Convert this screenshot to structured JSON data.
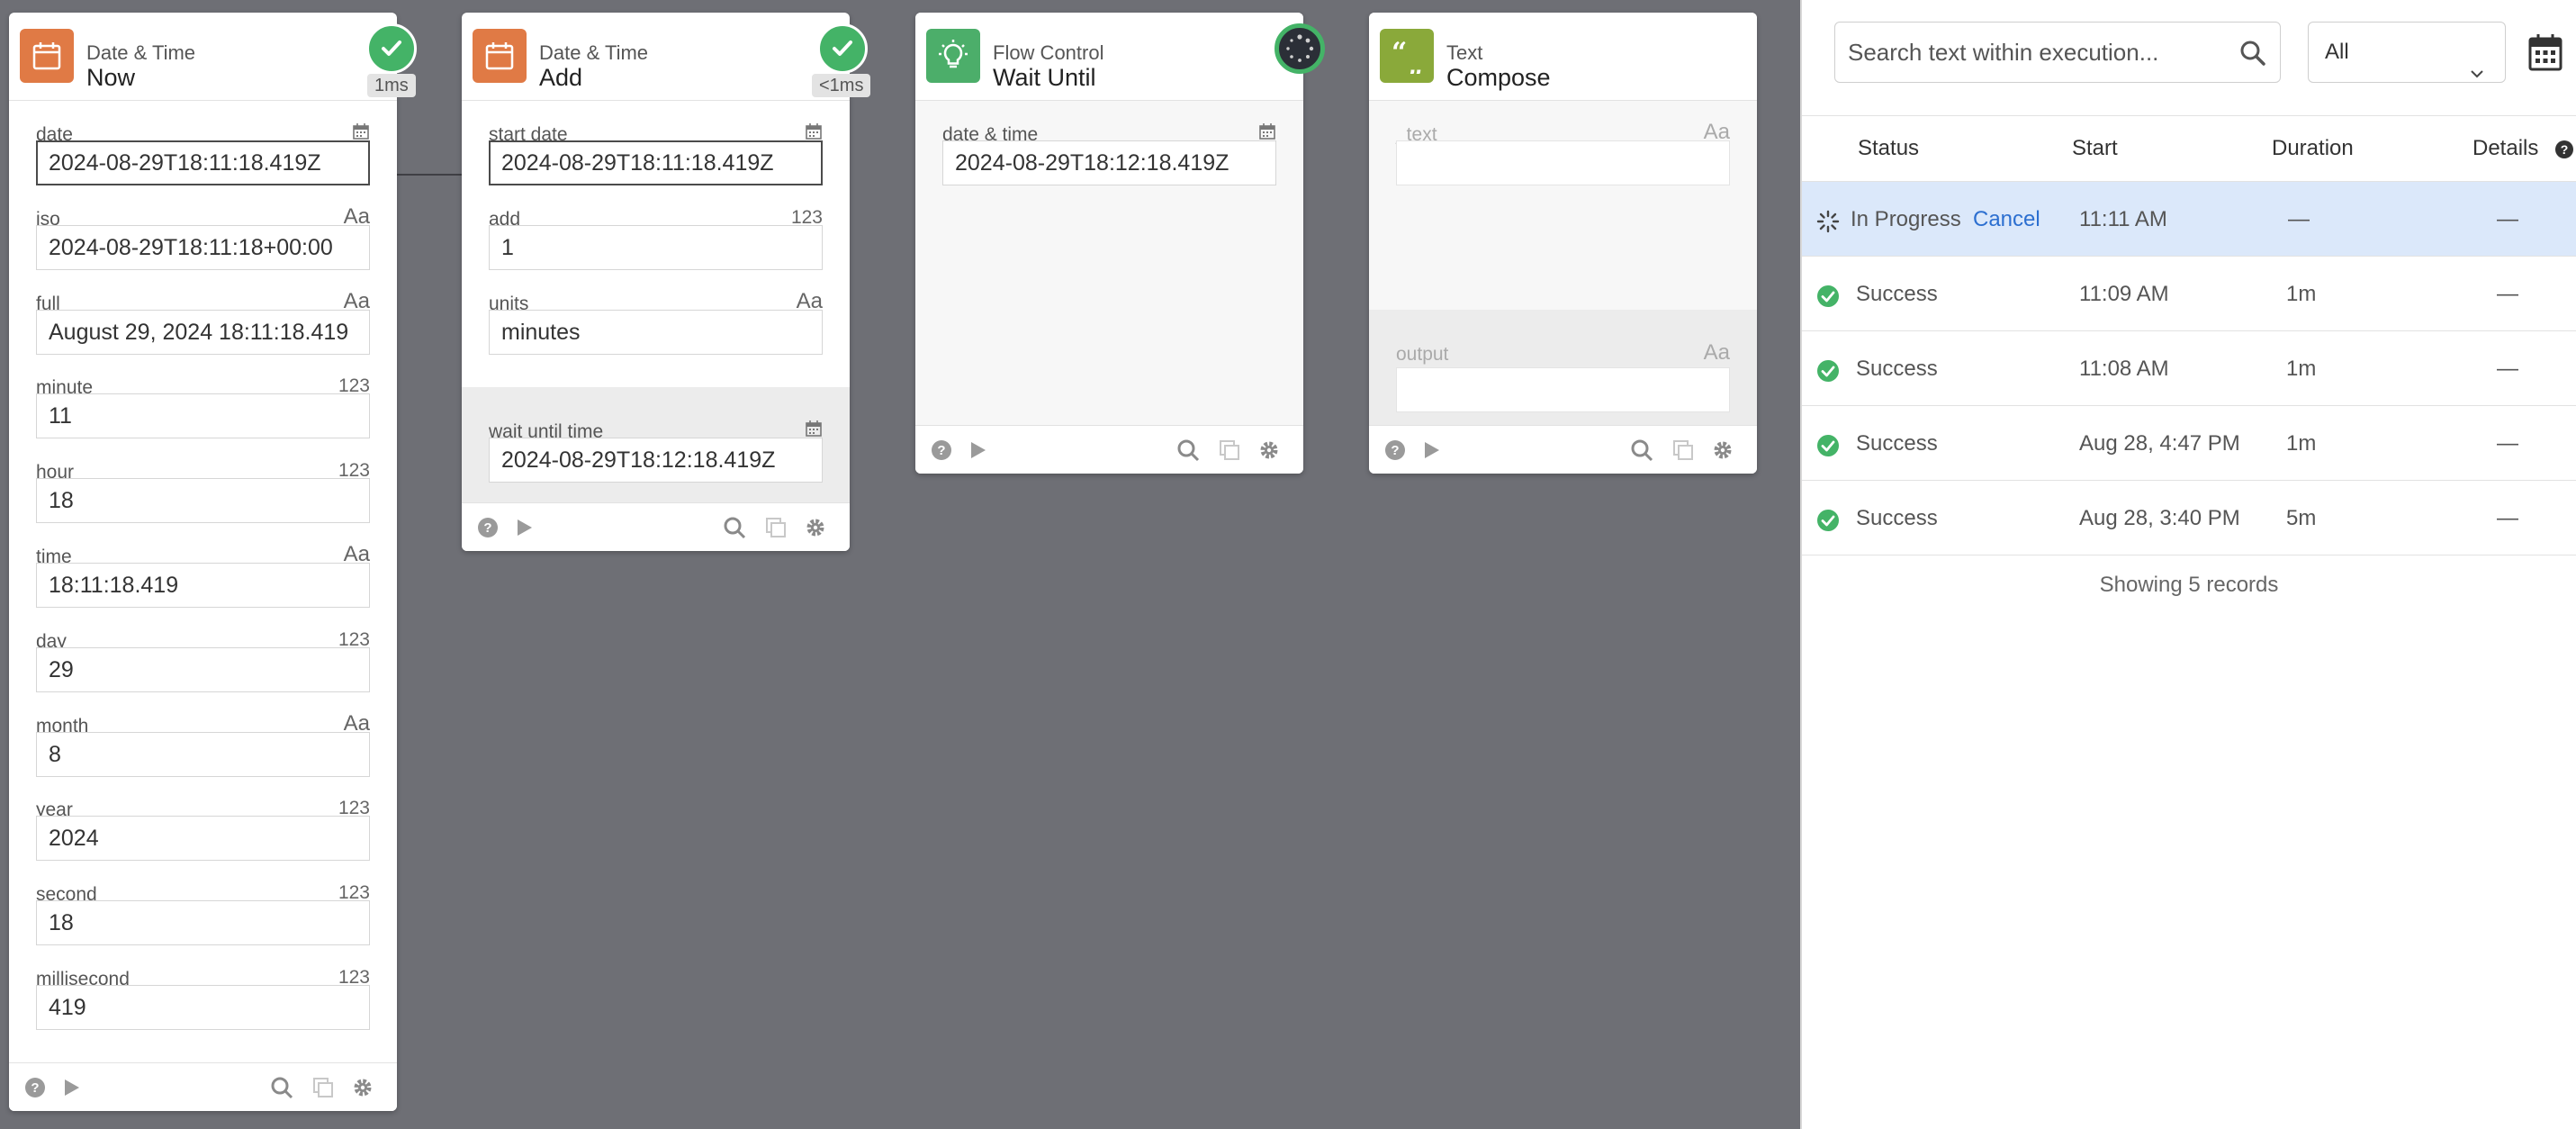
{
  "colors": {
    "canvas": "#6e6f75",
    "datetime_icon": "#e07a45",
    "flow_icon": "#4cae6a",
    "text_icon": "#8aa93a",
    "success": "#44b367",
    "link": "#2c6fd0",
    "highlight_row": "#dbe8fa"
  },
  "cards": {
    "now": {
      "category": "Date & Time",
      "title": "Now",
      "timing": "1ms",
      "icon": "calendar-icon",
      "fields": [
        {
          "label": "date",
          "type": "calendar",
          "value": "2024-08-29T18:11:18.419Z"
        },
        {
          "label": "iso",
          "type": "Aa",
          "value": "2024-08-29T18:11:18+00:00"
        },
        {
          "label": "full",
          "type": "Aa",
          "value": "August 29, 2024 18:11:18.419"
        },
        {
          "label": "minute",
          "type": "123",
          "value": "11"
        },
        {
          "label": "hour",
          "type": "123",
          "value": "18"
        },
        {
          "label": "time",
          "type": "Aa",
          "value": "18:11:18.419"
        },
        {
          "label": "day",
          "type": "123",
          "value": "29"
        },
        {
          "label": "month",
          "type": "Aa",
          "value": "8"
        },
        {
          "label": "year",
          "type": "123",
          "value": "2024"
        },
        {
          "label": "second",
          "type": "123",
          "value": "18"
        },
        {
          "label": "millisecond",
          "type": "123",
          "value": "419"
        }
      ]
    },
    "add": {
      "category": "Date & Time",
      "title": "Add",
      "timing": "<1ms",
      "icon": "calendar-icon",
      "fields": [
        {
          "label": "start date",
          "type": "calendar",
          "value": "2024-08-29T18:11:18.419Z"
        },
        {
          "label": "add",
          "type": "123",
          "value": "1"
        },
        {
          "label": "units",
          "type": "Aa",
          "value": "minutes"
        }
      ],
      "output": {
        "label": "wait until time",
        "type": "calendar",
        "value": "2024-08-29T18:12:18.419Z"
      }
    },
    "wait": {
      "category": "Flow Control",
      "title": "Wait Until",
      "icon": "lightbulb-icon",
      "fields": [
        {
          "label": "date & time",
          "type": "calendar",
          "value": "2024-08-29T18:12:18.419Z"
        }
      ]
    },
    "compose": {
      "category": "Text",
      "title": "Compose",
      "icon": "quote-icon",
      "fields": [
        {
          "label": "_text_",
          "type": "Aa",
          "value": ""
        }
      ],
      "output": {
        "label": "output",
        "type": "Aa",
        "value": ""
      }
    }
  },
  "panel": {
    "search_placeholder": "Search text within execution...",
    "filter_value": "All",
    "columns": {
      "status": "Status",
      "start": "Start",
      "duration": "Duration",
      "details": "Details"
    },
    "rows": [
      {
        "status": "In Progress",
        "action": "Cancel",
        "start": "11:11 AM",
        "duration": "—",
        "details": "—",
        "state": "progress"
      },
      {
        "status": "Success",
        "start": "11:09 AM",
        "duration": "1m",
        "details": "—",
        "state": "success"
      },
      {
        "status": "Success",
        "start": "11:08 AM",
        "duration": "1m",
        "details": "—",
        "state": "success"
      },
      {
        "status": "Success",
        "start": "Aug 28, 4:47 PM",
        "duration": "1m",
        "details": "—",
        "state": "success"
      },
      {
        "status": "Success",
        "start": "Aug 28, 3:40 PM",
        "duration": "5m",
        "details": "—",
        "state": "success"
      }
    ],
    "footer": "Showing 5 records"
  }
}
